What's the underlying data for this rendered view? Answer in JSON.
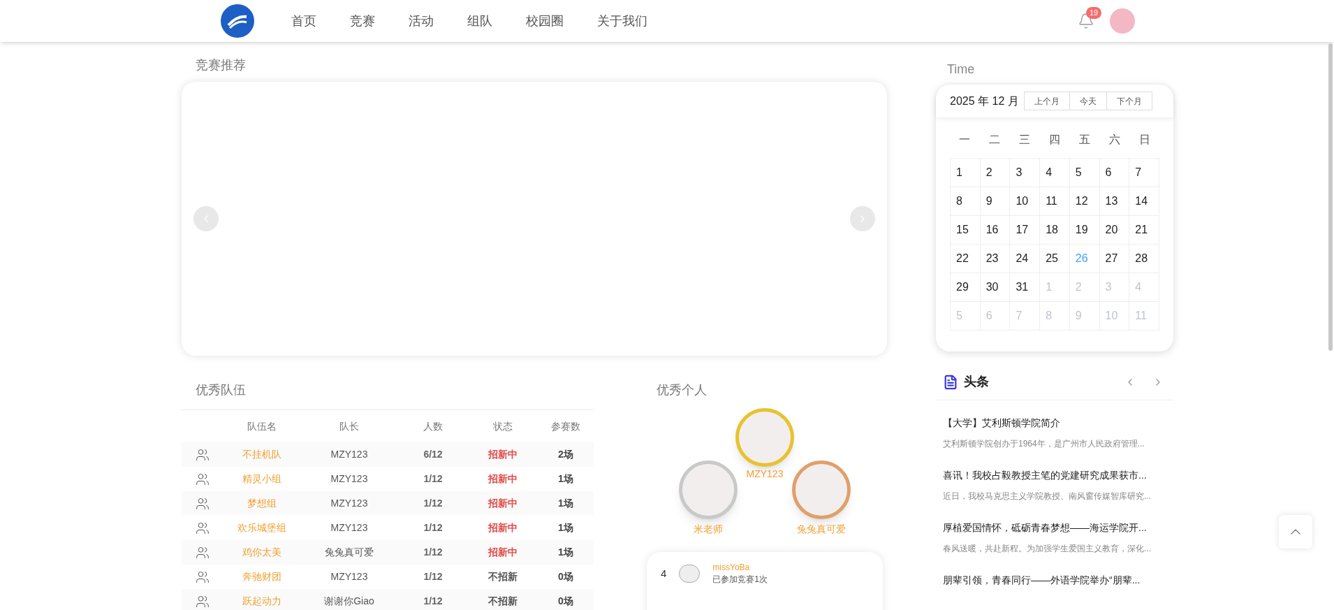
{
  "nav": {
    "items": [
      {
        "label": "首页",
        "selected": false
      },
      {
        "label": "竞赛",
        "selected": false
      },
      {
        "label": "活动",
        "selected": false
      },
      {
        "label": "组队",
        "selected": false
      },
      {
        "label": "校园圈",
        "selected": false
      },
      {
        "label": "关于我们",
        "selected": false
      }
    ],
    "notification_count": "19"
  },
  "carousel": {
    "title": "竞赛推荐"
  },
  "calendar": {
    "title": "Time",
    "month_label": "2025 年 12 月",
    "buttons": [
      "上个月",
      "今天",
      "下个月"
    ],
    "weekdays": [
      "一",
      "二",
      "三",
      "四",
      "五",
      "六",
      "日"
    ],
    "days": [
      {
        "day": "1",
        "muted": false,
        "today": false
      },
      {
        "day": "2",
        "muted": false,
        "today": false
      },
      {
        "day": "3",
        "muted": false,
        "today": false
      },
      {
        "day": "4",
        "muted": false,
        "today": false
      },
      {
        "day": "5",
        "muted": false,
        "today": false
      },
      {
        "day": "6",
        "muted": false,
        "today": false
      },
      {
        "day": "7",
        "muted": false,
        "today": false
      },
      {
        "day": "8",
        "muted": false,
        "today": false
      },
      {
        "day": "9",
        "muted": false,
        "today": false
      },
      {
        "day": "10",
        "muted": false,
        "today": false
      },
      {
        "day": "11",
        "muted": false,
        "today": false
      },
      {
        "day": "12",
        "muted": false,
        "today": false
      },
      {
        "day": "13",
        "muted": false,
        "today": false
      },
      {
        "day": "14",
        "muted": false,
        "today": false
      },
      {
        "day": "15",
        "muted": false,
        "today": false
      },
      {
        "day": "16",
        "muted": false,
        "today": false
      },
      {
        "day": "17",
        "muted": false,
        "today": false
      },
      {
        "day": "18",
        "muted": false,
        "today": false
      },
      {
        "day": "19",
        "muted": false,
        "today": false
      },
      {
        "day": "20",
        "muted": false,
        "today": false
      },
      {
        "day": "21",
        "muted": false,
        "today": false
      },
      {
        "day": "22",
        "muted": false,
        "today": false
      },
      {
        "day": "23",
        "muted": false,
        "today": false
      },
      {
        "day": "24",
        "muted": false,
        "today": false
      },
      {
        "day": "25",
        "muted": false,
        "today": false
      },
      {
        "day": "26",
        "muted": false,
        "today": true
      },
      {
        "day": "27",
        "muted": false,
        "today": false
      },
      {
        "day": "28",
        "muted": false,
        "today": false
      },
      {
        "day": "29",
        "muted": false,
        "today": false
      },
      {
        "day": "30",
        "muted": false,
        "today": false
      },
      {
        "day": "31",
        "muted": false,
        "today": false
      },
      {
        "day": "1",
        "muted": true,
        "today": false
      },
      {
        "day": "2",
        "muted": true,
        "today": false
      },
      {
        "day": "3",
        "muted": true,
        "today": false
      },
      {
        "day": "4",
        "muted": true,
        "today": false
      },
      {
        "day": "5",
        "muted": true,
        "today": false
      },
      {
        "day": "6",
        "muted": true,
        "today": false
      },
      {
        "day": "7",
        "muted": true,
        "today": false
      },
      {
        "day": "8",
        "muted": true,
        "today": false
      },
      {
        "day": "9",
        "muted": true,
        "today": false
      },
      {
        "day": "10",
        "muted": true,
        "today": false
      },
      {
        "day": "11",
        "muted": true,
        "today": false
      }
    ]
  },
  "teams": {
    "title": "优秀队伍",
    "columns": [
      "队伍名",
      "队长",
      "人数",
      "状态",
      "参赛数"
    ],
    "rows": [
      {
        "name": "不挂机队",
        "captain": "MZY123",
        "members": "6/12",
        "status": "招新中",
        "recruiting": true,
        "matches": "2场"
      },
      {
        "name": "精灵小组",
        "captain": "MZY123",
        "members": "1/12",
        "status": "招新中",
        "recruiting": true,
        "matches": "1场"
      },
      {
        "name": "梦想组",
        "captain": "MZY123",
        "members": "1/12",
        "status": "招新中",
        "recruiting": true,
        "matches": "1场"
      },
      {
        "name": "欢乐城堡组",
        "captain": "MZY123",
        "members": "1/12",
        "status": "招新中",
        "recruiting": true,
        "matches": "1场"
      },
      {
        "name": "鸡你太美",
        "captain": "兔兔真可爱",
        "members": "1/12",
        "status": "招新中",
        "recruiting": true,
        "matches": "1场"
      },
      {
        "name": "奔驰财团",
        "captain": "MZY123",
        "members": "1/12",
        "status": "不招新",
        "recruiting": false,
        "matches": "0场"
      },
      {
        "name": "跃起动力",
        "captain": "谢谢你Giao",
        "members": "1/12",
        "status": "不招新",
        "recruiting": false,
        "matches": "0场"
      }
    ]
  },
  "individuals": {
    "title": "优秀个人",
    "podium": [
      {
        "name": "MZY123",
        "color": "#e8c22f"
      },
      {
        "name": "米老师",
        "color": "#c9c9c9"
      },
      {
        "name": "兔兔真可爱",
        "color": "#e0a06a"
      }
    ],
    "ranking": [
      {
        "rank": "4",
        "name": "missYoBa",
        "note": "已参加竞赛1次"
      }
    ]
  },
  "headlines": {
    "title": "头条",
    "items": [
      {
        "title": "【大学】艾利斯顿学院简介",
        "summary": "艾利斯顿学院创办于1964年，是广州市人民政府管理..."
      },
      {
        "title": "喜讯！我校占毅教授主笔的党建研究成果获市...",
        "summary": "近日，我校马克思主义学院教授、南风窗传媒智库研究..."
      },
      {
        "title": "厚植爱国情怀，砥砺青春梦想——海运学院开...",
        "summary": "春风送暖，共赴新程。为加强学生爱国主义教育，深化..."
      },
      {
        "title": "朋辈引领，青春同行——外语学院举办“朋辈..."
      }
    ]
  }
}
